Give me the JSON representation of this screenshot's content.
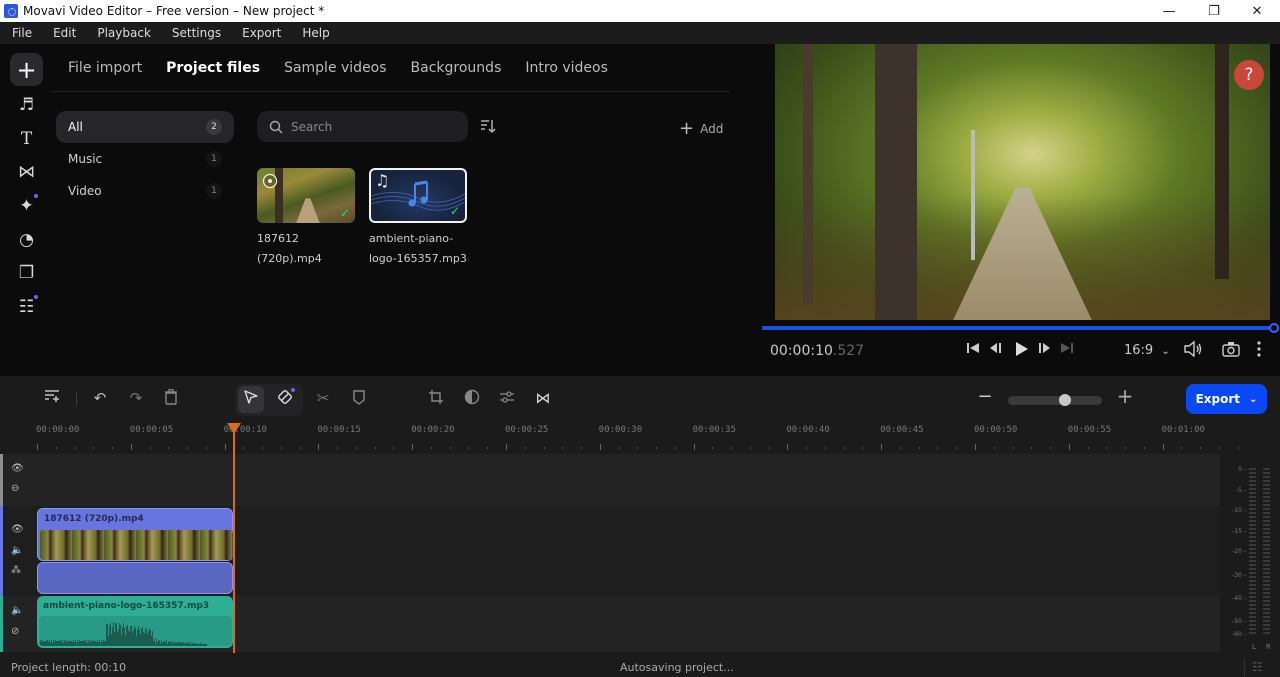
{
  "window": {
    "title": "Movavi Video Editor – Free version – New project *",
    "controls": {
      "minimize": "—",
      "maximize": "❐",
      "close": "✕"
    }
  },
  "menu": [
    "File",
    "Edit",
    "Playback",
    "Settings",
    "Export",
    "Help"
  ],
  "left_nav": [
    {
      "name": "import",
      "icon": "+",
      "active": true
    },
    {
      "name": "music",
      "icon": "♬"
    },
    {
      "name": "titles",
      "icon": "T"
    },
    {
      "name": "transitions",
      "icon": "⋈"
    },
    {
      "name": "effects",
      "icon": "✦",
      "dot": true
    },
    {
      "name": "stickers",
      "icon": "◔"
    },
    {
      "name": "store",
      "icon": "❐"
    },
    {
      "name": "more",
      "icon": "☷",
      "dot": true
    }
  ],
  "media": {
    "tabs": [
      "File import",
      "Project files",
      "Sample videos",
      "Backgrounds",
      "Intro videos"
    ],
    "active_tab": "Project files",
    "categories": [
      {
        "label": "All",
        "count": "2"
      },
      {
        "label": "Music",
        "count": "1"
      },
      {
        "label": "Video",
        "count": "1"
      }
    ],
    "search_placeholder": "Search",
    "add_label": "Add",
    "files": [
      {
        "name_line1": "187612",
        "name_line2": "(720p).mp4",
        "type": "video"
      },
      {
        "name_line1": "ambient-piano-",
        "name_line2": "logo-165357.mp3",
        "type": "audio"
      }
    ]
  },
  "preview": {
    "help": "?",
    "timecode_main": "00:00:10",
    "timecode_ms": ".527",
    "aspect": "16:9",
    "progress_percent": 100
  },
  "timeline": {
    "export_label": "Export",
    "ruler": [
      "00:00:00",
      "00:00:05",
      "00:00:10",
      "00:00:15",
      "00:00:20",
      "00:00:25",
      "00:00:30",
      "00:00:35",
      "00:00:40",
      "00:00:45",
      "00:00:50",
      "00:00:55",
      "00:01:00"
    ],
    "playhead_time": "00:00:10",
    "clips": {
      "video": "187612 (720p).mp4",
      "audio": "ambient-piano-logo-165357.mp3"
    },
    "meter_labels": [
      "0",
      "-5",
      "-10",
      "-15",
      "-20",
      "-30",
      "-40",
      "-50",
      "-60"
    ],
    "meter_channels": [
      "L",
      "R"
    ],
    "zoom_level_percent": 55
  },
  "status": {
    "project_length": "Project length: 00:10",
    "autosave": "Autosaving project..."
  },
  "colors": {
    "accent": "#0b48f5",
    "playhead": "#e06a1a",
    "video_clip": "#6675e0",
    "audio_clip": "#2fae96",
    "help": "#c9473a"
  }
}
